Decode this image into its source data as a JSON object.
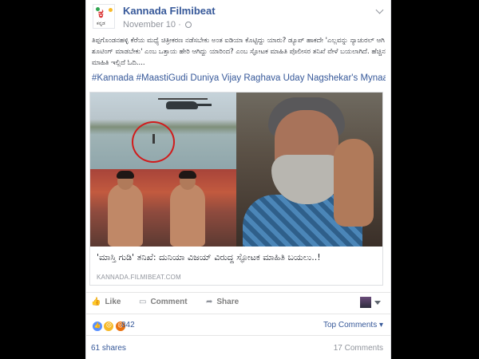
{
  "page": {
    "name": "Kannada Filmibeat",
    "logo_letter": "ಕ",
    "logo_subtitle": "ಕನ್ನಡ"
  },
  "post": {
    "date": "November 10",
    "meta_separator": "·",
    "body_text": "ತಿಪ್ಪಗೊಂಡನಹಳ್ಳಿ ಕೆರೆಯ ಮಧ್ಯೆ ಚಿತ್ರೀಕರಣ ನಡೆಸಬೇಕು ಅಂತ ಐಡಿಯಾ ಕೊಟ್ಟಿದ್ದು ಯಾರು? ಡ್ಯೂಪ್ ಹಾಕದೇ 'ಎಲ್ಲವನ್ನು ನ್ಯಾಚುರಲ್ ಆಗಿ ಶೂಟಿಂಗ್ ಮಾಡಬೇಕು' ಎಂಬ ಒತ್ತಾಯ ಹೇರಿ ಆಗಿದ್ದು ಯಾರಿಂದ? ಎಂಬ ಸ್ಫೋಟಕ ಮಾಹಿತಿ ಪೊಲೀಸರ ತನಿಖೆ ವೇಳೆ ಬಯಲಾಗಿದೆ. ಹೆಚ್ಚಿನ ಮಾಹಿತಿ ಇಲ್ಲಿದೆ ಓದಿ....",
    "hashtags": [
      "#Kannada",
      "#MaastiGudi",
      "Duniya",
      "Vijay",
      "Raghava",
      "Uday",
      "Nagshekar's",
      "Mynaa"
    ]
  },
  "link_preview": {
    "title": "'ಮಾಸ್ತಿ ಗುಡಿ' ತನಿಖೆ: ದುನಿಯಾ ವಿಜಯ್ ವಿರುದ್ಧ ಸ್ಫೋಟಕ ಮಾಹಿತಿ ಬಯಲು..!",
    "domain": "KANNADA.FILMIBEAT.COM"
  },
  "actions": {
    "like_label": "Like",
    "comment_label": "Comment",
    "share_label": "Share"
  },
  "reactions": {
    "count": "842",
    "icons": [
      "like-reaction",
      "sad-reaction",
      "angry-reaction"
    ],
    "top_comments_label": "Top Comments ▾"
  },
  "stats": {
    "shares": "61 shares",
    "comments": "17 Comments"
  },
  "colors": {
    "link_blue": "#365899",
    "meta_gray": "#90949c",
    "like_blue": "#5890ff",
    "sad_yellow": "#f7b928",
    "angry_red": "#e9710f",
    "logo_red": "#d82b2b"
  }
}
